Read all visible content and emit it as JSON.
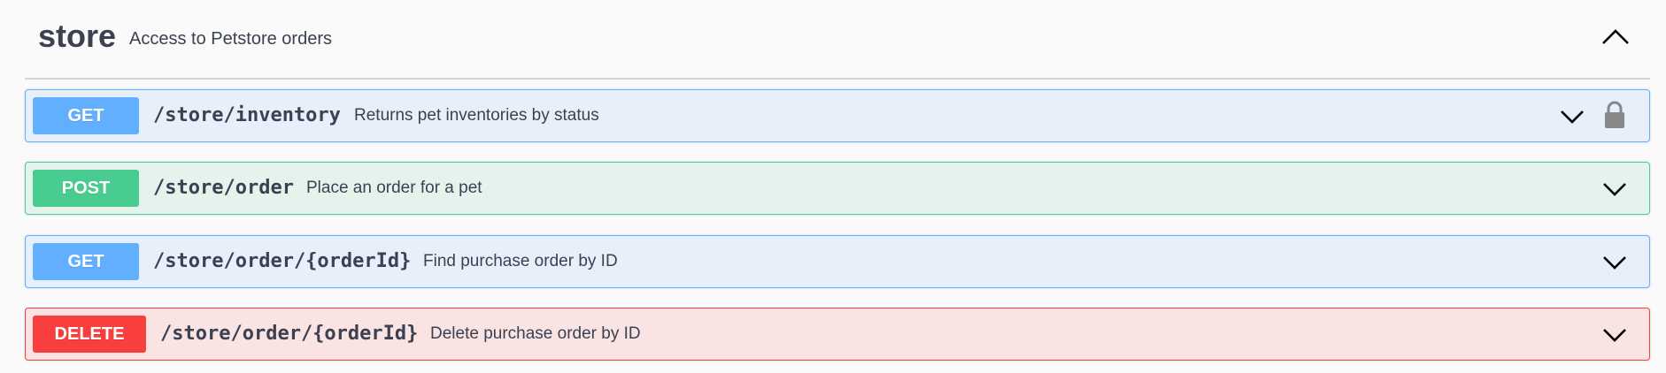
{
  "tag": {
    "name": "store",
    "description": "Access to Petstore orders",
    "toggle_icon": "chevron-up-icon"
  },
  "operations": [
    {
      "method": "GET",
      "path": "/store/inventory",
      "summary": "Returns pet inventories by status",
      "color": "#61affe",
      "locked": true
    },
    {
      "method": "POST",
      "path": "/store/order",
      "summary": "Place an order for a pet",
      "color": "#49cc90",
      "locked": false
    },
    {
      "method": "GET",
      "path": "/store/order/{orderId}",
      "summary": "Find purchase order by ID",
      "color": "#61affe",
      "locked": false
    },
    {
      "method": "DELETE",
      "path": "/store/order/{orderId}",
      "summary": "Delete purchase order by ID",
      "color": "#f93e3e",
      "locked": false
    }
  ]
}
